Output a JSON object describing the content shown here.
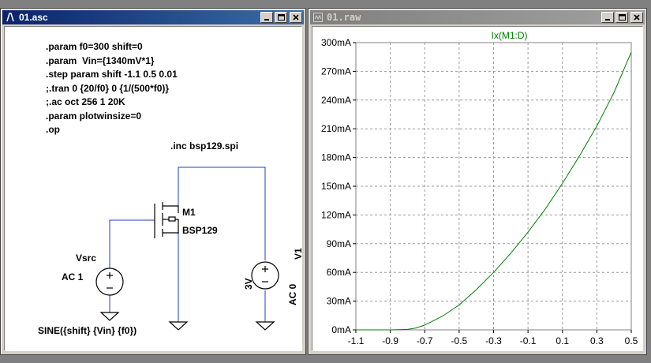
{
  "schematic_window": {
    "title": "01.asc",
    "directives": [
      ".param f0=300 shift=0",
      ".param  Vin={1340mV*1}",
      ".step param shift -1.1 0.5 0.01",
      ";.tran 0 {20/f0} 0 {1/(500*f0)}",
      ";.ac oct 256 1 20K",
      ".param plotwinsize=0",
      ".op"
    ],
    "include": ".inc bsp129.spi",
    "mosfet": {
      "ref": "M1",
      "model": "BSP129"
    },
    "vsrc": {
      "name": "Vsrc",
      "ac": "AC 1",
      "value": "SINE({shift} {Vin} {f0})"
    },
    "v1": {
      "name": "V1",
      "value": "3V",
      "ac": "AC 0"
    }
  },
  "plot_window": {
    "title": "01.raw",
    "trace_color": "#008000",
    "grid_color": "#9a9a9a"
  },
  "chart_data": {
    "type": "line",
    "title": "Ix(M1:D)",
    "xlabel": "",
    "ylabel": "",
    "xlim": [
      -1.1,
      0.5
    ],
    "ylim": [
      0,
      300
    ],
    "x_ticks": [
      "-1.1",
      "-0.9",
      "-0.7",
      "-0.5",
      "-0.3",
      "-0.1",
      "0.1",
      "0.3",
      "0.5"
    ],
    "y_ticks": [
      "0mA",
      "30mA",
      "60mA",
      "90mA",
      "120mA",
      "150mA",
      "180mA",
      "210mA",
      "240mA",
      "270mA",
      "300mA"
    ],
    "grid": true,
    "series": [
      {
        "name": "Ix(M1:D)",
        "x": [
          -1.1,
          -1.0,
          -0.9,
          -0.8,
          -0.75,
          -0.7,
          -0.6,
          -0.5,
          -0.4,
          -0.3,
          -0.2,
          -0.1,
          0.0,
          0.1,
          0.2,
          0.3,
          0.4,
          0.5
        ],
        "y": [
          0,
          0,
          0,
          0.5,
          2,
          5,
          14,
          26,
          42,
          60,
          80,
          102,
          126,
          153,
          182,
          213,
          248,
          290
        ]
      }
    ]
  }
}
